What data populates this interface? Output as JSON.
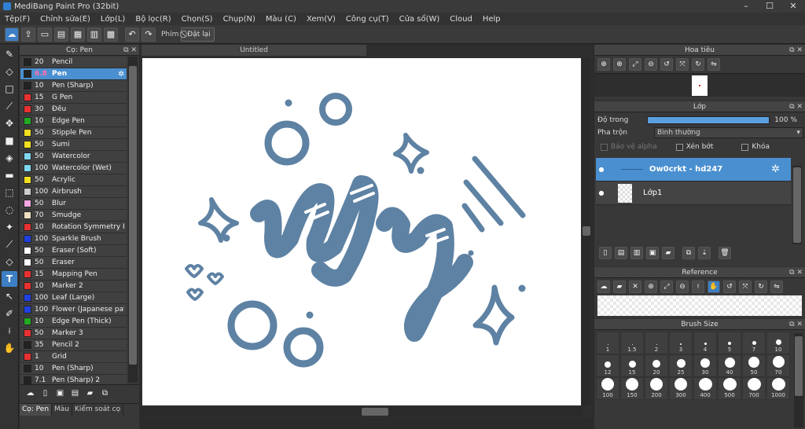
{
  "app": {
    "title": "MediBang Paint Pro (32bit)"
  },
  "menu": [
    "Tệp(F)",
    "Chỉnh sửa(E)",
    "Lớp(L)",
    "Bộ lọc(R)",
    "Chọn(S)",
    "Chụp(N)",
    "Màu (C)",
    "Xem(V)",
    "Công cụ(T)",
    "Cửa sổ(W)",
    "Cloud",
    "Help"
  ],
  "toolbar": {
    "key_label": "Phím",
    "reset_label": "Đặt lại"
  },
  "brush_panel": {
    "title": "Cọ: Pen",
    "items": [
      {
        "size": "20",
        "name": "Pencil",
        "color": "#222222"
      },
      {
        "size": "6.8",
        "name": "Pen",
        "color": "#222222"
      },
      {
        "size": "10",
        "name": "Pen (Sharp)",
        "color": "#222222"
      },
      {
        "size": "15",
        "name": "G Pen",
        "color": "#e83030"
      },
      {
        "size": "30",
        "name": "Đều",
        "color": "#e83030"
      },
      {
        "size": "10",
        "name": "Edge Pen",
        "color": "#22aa22"
      },
      {
        "size": "50",
        "name": "Stipple Pen",
        "color": "#f0e020"
      },
      {
        "size": "50",
        "name": "Sumi",
        "color": "#f0e020"
      },
      {
        "size": "50",
        "name": "Watercolor",
        "color": "#80d8f0"
      },
      {
        "size": "100",
        "name": "Watercolor (Wet)",
        "color": "#80d8f0"
      },
      {
        "size": "50",
        "name": "Acrylic",
        "color": "#f0e020"
      },
      {
        "size": "100",
        "name": "Airbrush",
        "color": "#cccccc"
      },
      {
        "size": "50",
        "name": "Blur",
        "color": "#f5a8e0"
      },
      {
        "size": "70",
        "name": "Smudge",
        "color": "#f0e0c0"
      },
      {
        "size": "10",
        "name": "Rotation Symmetry Pen",
        "color": "#e83030"
      },
      {
        "size": "100",
        "name": "Sparkle Brush",
        "color": "#2040e0"
      },
      {
        "size": "50",
        "name": "Eraser (Soft)",
        "color": "#ffffff"
      },
      {
        "size": "50",
        "name": "Eraser",
        "color": "#ffffff"
      },
      {
        "size": "15",
        "name": "Mapping Pen",
        "color": "#e83030"
      },
      {
        "size": "10",
        "name": "Marker 2",
        "color": "#e83030"
      },
      {
        "size": "100",
        "name": "Leaf (Large)",
        "color": "#2040e0"
      },
      {
        "size": "100",
        "name": "Flower (Japanese pattern)",
        "color": "#2040e0"
      },
      {
        "size": "10",
        "name": "Edge Pen (Thick)",
        "color": "#22aa22"
      },
      {
        "size": "50",
        "name": "Marker 3",
        "color": "#e83030"
      },
      {
        "size": "35",
        "name": "Pencil 2",
        "color": "#222222"
      },
      {
        "size": "1",
        "name": "Grid",
        "color": "#e83030"
      },
      {
        "size": "10",
        "name": "Pen (Sharp)",
        "color": "#222222"
      },
      {
        "size": "7.1",
        "name": "Pen (Sharp) 2",
        "color": "#222222"
      }
    ],
    "tabs": [
      "Cọ: Pen",
      "Màu",
      "Kiểm soát cọ"
    ]
  },
  "canvas": {
    "tab": "Untitled",
    "ink_color": "#5e82a3"
  },
  "navigator": {
    "title": "Hoa tiêu"
  },
  "layers": {
    "title": "Lớp",
    "opacity_label": "Độ trong",
    "opacity_value": "100 %",
    "opacity_fraction": 1.0,
    "blend_label": "Pha trộn",
    "blend_value": "Bình thường",
    "protect_alpha": "Bảo vệ alpha",
    "clipping": "Xén bớt",
    "lock": "Khóa",
    "items": [
      {
        "name": "Ow0crkt - hd247",
        "selected": true
      },
      {
        "name": "Lớp1",
        "selected": false
      }
    ]
  },
  "reference": {
    "title": "Reference"
  },
  "brush_size": {
    "title": "Brush Size",
    "sizes": [
      "1",
      "1.5",
      "2",
      "3",
      "4",
      "5",
      "7",
      "10",
      "12",
      "15",
      "20",
      "25",
      "30",
      "40",
      "50",
      "70",
      "100",
      "150",
      "200",
      "300",
      "400",
      "500",
      "700",
      "1000"
    ]
  }
}
